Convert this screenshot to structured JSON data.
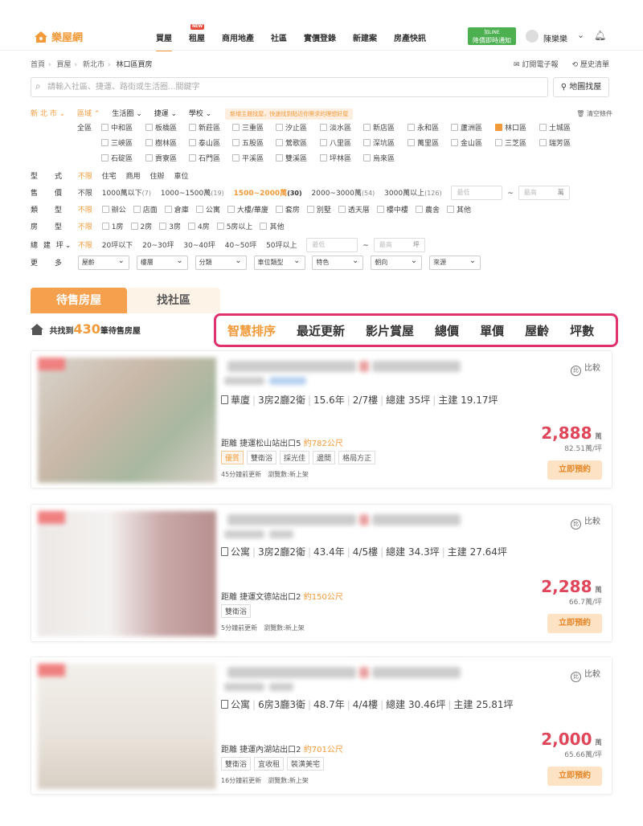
{
  "header": {
    "logo": "樂屋網",
    "nav": [
      {
        "label": "買屋",
        "active": true
      },
      {
        "label": "租屋",
        "badge": "NEW"
      },
      {
        "label": "商用地產"
      },
      {
        "label": "社區"
      },
      {
        "label": "實價登錄"
      },
      {
        "label": "新建案"
      },
      {
        "label": "房產快訊"
      }
    ],
    "line_banner_top": "加LINE",
    "line_banner_main": "降價即時通知",
    "user_name": "陳樂樂"
  },
  "breadcrumb": [
    "首頁",
    "買屋",
    "新北市",
    "林口區買房"
  ],
  "subscribe": "訂閱電子報",
  "history": "歷史清單",
  "search": {
    "placeholder": "請輸入社區、捷運、路街或生活圈...關鍵字",
    "map_button": "地圖找屋"
  },
  "filters": {
    "city": "新 北 市",
    "region_tab": "區域",
    "tabs": [
      "生活圈",
      "捷運",
      "學校"
    ],
    "tooltip": "新增主題找屋，快速找到貼近你需求的理想好屋",
    "clear": "清空條件",
    "districts": [
      [
        "全區",
        "中和區",
        "板橋區",
        "新莊區",
        "三重區",
        "汐止區",
        "淡水區",
        "新店區",
        "永和區",
        "蘆洲區",
        "林口區",
        "土城區"
      ],
      [
        "三峽區",
        "樹林區",
        "泰山區",
        "五股區",
        "鶯歌區",
        "八里區",
        "深坑區",
        "萬里區",
        "金山區",
        "三芝區",
        "瑞芳區"
      ],
      [
        "石碇區",
        "貢寮區",
        "石門區",
        "平溪區",
        "雙溪區",
        "坪林區",
        "烏來區"
      ]
    ],
    "checked_district": "林口區",
    "type_label": "型　式",
    "type_opts": [
      "不限",
      "住宅",
      "商用",
      "住辦",
      "車位"
    ],
    "price_label": "售　價",
    "price_opts": [
      {
        "label": "不限"
      },
      {
        "label": "1000萬以下",
        "count": "(7)"
      },
      {
        "label": "1000~1500萬",
        "count": "(19)"
      },
      {
        "label": "1500~2000萬",
        "count": "(30)",
        "active": true
      },
      {
        "label": "2000~3000萬",
        "count": "(54)"
      },
      {
        "label": "3000萬以上",
        "count": "(126)"
      }
    ],
    "price_min": "最低",
    "price_max": "最高",
    "price_unit": "萬",
    "kind_label": "類　型",
    "kind_opts": [
      "辦公",
      "店面",
      "倉庫",
      "公寓",
      "大樓/華廈",
      "套房",
      "別墅",
      "透天厝",
      "樓中樓",
      "農舍",
      "其他"
    ],
    "room_label": "房　型",
    "room_opts": [
      "1房",
      "2房",
      "3房",
      "4房",
      "5房以上",
      "其他"
    ],
    "area_label": "總 建 坪",
    "area_opts": [
      "不限",
      "20坪以下",
      "20~30坪",
      "30~40坪",
      "40~50坪",
      "50坪以上"
    ],
    "area_unit": "坪",
    "more_label": "更　多",
    "more_selects": [
      "屋齡",
      "樓層",
      "分類",
      "車位類型",
      "特色",
      "朝向",
      "來源"
    ]
  },
  "tabs": {
    "sale": "待售房屋",
    "community": "找社區"
  },
  "count": {
    "prefix": "共找到",
    "num": "430",
    "suffix": "筆待售房屋"
  },
  "sort": [
    "智慧排序",
    "最近更新",
    "影片賞屋",
    "總價",
    "單價",
    "屋齡",
    "坪數"
  ],
  "compare_label": "比較",
  "book_label": "立即預約",
  "listings": [
    {
      "type": "華廈",
      "layout": "3房2廳2衛",
      "area": "15.6年",
      "floor": "2/7樓",
      "gross": "總建 35坪",
      "main": "主建 19.17坪",
      "station": "距離 捷運松山站出口5",
      "distance": "約782公尺",
      "tags": [
        "優質",
        "雙衛浴",
        "採光佳",
        "邊間",
        "格局方正"
      ],
      "updated": "45分鐘前更新",
      "views": "瀏覽數:新上架",
      "price": "2,888",
      "unit": "萬",
      "per": "82.51萬/坪"
    },
    {
      "type": "公寓",
      "layout": "3房2廳2衛",
      "area": "43.4年",
      "floor": "4/5樓",
      "gross": "總建 34.3坪",
      "main": "主建 27.64坪",
      "station": "距離 捷運文德站出口2",
      "distance": "約150公尺",
      "tags": [
        "雙衛浴"
      ],
      "updated": "5分鐘前更新",
      "views": "瀏覽數:新上架",
      "price": "2,288",
      "unit": "萬",
      "per": "66.7萬/坪"
    },
    {
      "type": "公寓",
      "layout": "6房3廳3衛",
      "area": "48.7年",
      "floor": "4/4樓",
      "gross": "總建 30.46坪",
      "main": "主建 25.81坪",
      "station": "距離 捷運內湖站出口2",
      "distance": "約701公尺",
      "tags": [
        "雙衛浴",
        "宜收租",
        "裝潢美宅"
      ],
      "updated": "16分鐘前更新",
      "views": "瀏覽數:新上架",
      "price": "2,000",
      "unit": "萬",
      "per": "65.66萬/坪"
    }
  ],
  "colors": {
    "accent": "#f29a3a",
    "price": "#e0465a",
    "highlight_border": "#e0336e"
  }
}
